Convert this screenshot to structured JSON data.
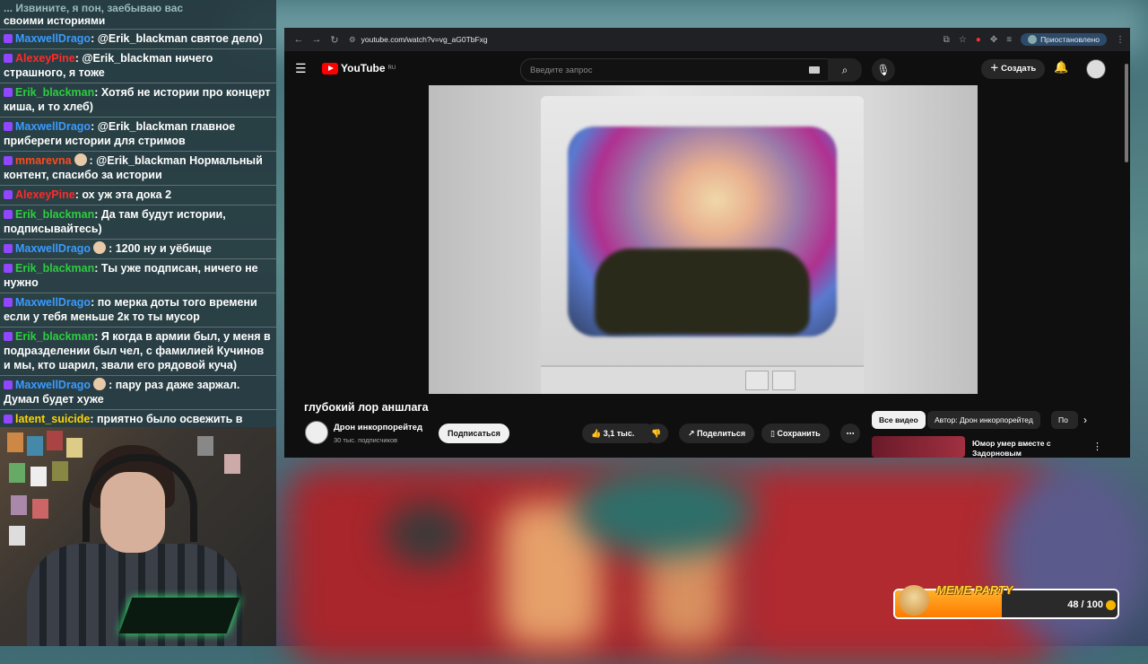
{
  "chat": {
    "top_text_faded": "... Извините, я пон, заебываю вас",
    "top_text": "своими историями",
    "messages": [
      {
        "user": "MaxwellDrago",
        "user_color": "blue",
        "text": ": @Erik_blackman святое дело)",
        "emote": false
      },
      {
        "user": "AlexeyPine",
        "user_color": "red",
        "text": ": @Erik_blackman ничего страшного, я тоже",
        "emote": false
      },
      {
        "user": "Erik_blackman",
        "user_color": "green",
        "text": ": Хотяб не истории про концерт киша, и то хлеб)",
        "emote": false
      },
      {
        "user": "MaxwellDrago",
        "user_color": "blue",
        "text": ": @Erik_blackman главное прибереги истории для стримов",
        "emote": false
      },
      {
        "user": "mmarevna",
        "user_color": "orange",
        "text": ": @Erik_blackman Нормальный контент, спасибо за истории",
        "emote": true
      },
      {
        "user": "AlexeyPine",
        "user_color": "red",
        "text": ": ох уж эта дока 2",
        "emote": false
      },
      {
        "user": "Erik_blackman",
        "user_color": "green",
        "text": ": Да там будут истории, подписывайтесь)",
        "emote": false
      },
      {
        "user": "MaxwellDrago",
        "user_color": "blue",
        "text": ": 1200 ну и уёбище",
        "emote": true
      },
      {
        "user": "Erik_blackman",
        "user_color": "green",
        "text": ": Ты уже подписан, ничего не нужно",
        "emote": false
      },
      {
        "user": "MaxwellDrago",
        "user_color": "blue",
        "text": ": по мерка доты того времени если у тебя меньше 2к то ты мусор",
        "emote": false
      },
      {
        "user": "Erik_blackman",
        "user_color": "green",
        "text": ": Я когда в армии был, у меня в подразделении был чел, с фамилией Кучинов и мы, кто шарил, звали его рядовой куча)",
        "emote": false
      },
      {
        "user": "MaxwellDrago",
        "user_color": "blue",
        "text": ": пару раз даже заржал. Думал будет хуже",
        "emote": true
      },
      {
        "user": "latent_suicide",
        "user_color": "yellow",
        "text": ": приятно было освежить в голове",
        "emote": false
      }
    ]
  },
  "browser": {
    "url": "youtube.com/watch?v=vg_aG0TbFxg",
    "paused_label": "Приостановлено"
  },
  "youtube": {
    "logo_text": "YouTube",
    "logo_region": "RU",
    "search_placeholder": "Введите запрос",
    "create_label": "Создать",
    "video_title": "глубокий лор аншлага",
    "channel_name": "Дрон инкорпорейтед",
    "channel_subs": "30 тыс. подписчиков",
    "subscribe_label": "Подписаться",
    "like_count": "3,1 тыс.",
    "share_label": "Поделиться",
    "save_label": "Сохранить",
    "chips": [
      "Все видео",
      "Автор: Дрон инкорпорейтед",
      "По"
    ],
    "rec_title": "Юмор умер вместе с Задорновым"
  },
  "meme_party": {
    "title": "MEME PARTY",
    "count": "48 / 100",
    "progress": 0.48
  },
  "colors": {
    "blue": "#3a9bff",
    "red": "#ff2a2a",
    "green": "#2ecc40",
    "orange": "#ff4a1a",
    "yellow": "#ffd400",
    "yt_red": "#ff0000"
  }
}
